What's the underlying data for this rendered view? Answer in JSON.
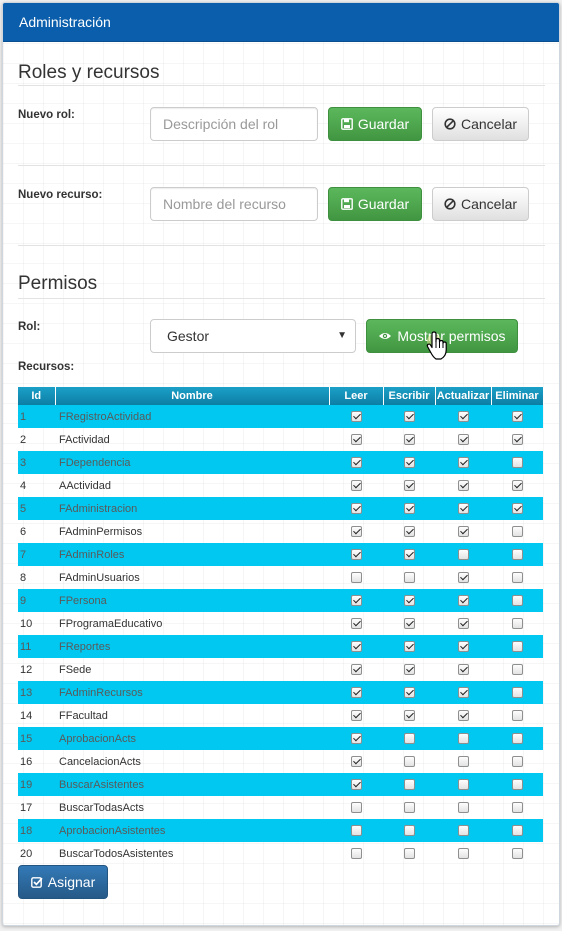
{
  "header": {
    "title": "Administración"
  },
  "roles_section": {
    "title": "Roles y recursos",
    "new_role_label": "Nuevo rol:",
    "new_role_placeholder": "Descripción del rol",
    "new_resource_label": "Nuevo recurso:",
    "new_resource_placeholder": "Nombre del recurso",
    "save_label": "Guardar",
    "cancel_label": "Cancelar"
  },
  "permisos_section": {
    "title": "Permisos",
    "role_label": "Rol:",
    "role_selected": "Gestor",
    "show_button_label": "Mostrar permisos",
    "resources_label": "Recursos:",
    "assign_label": "Asignar"
  },
  "table": {
    "columns": [
      "Id",
      "Nombre",
      "Leer",
      "Escribir",
      "Actualizar",
      "Eliminar"
    ],
    "rows": [
      {
        "id": "1",
        "name": "FRegistroActividad",
        "perms": [
          true,
          true,
          true,
          true
        ]
      },
      {
        "id": "2",
        "name": "FActividad",
        "perms": [
          true,
          true,
          true,
          true
        ]
      },
      {
        "id": "3",
        "name": "FDependencia",
        "perms": [
          true,
          true,
          true,
          false
        ]
      },
      {
        "id": "4",
        "name": "AActividad",
        "perms": [
          true,
          true,
          true,
          true
        ]
      },
      {
        "id": "5",
        "name": "FAdministracion",
        "perms": [
          true,
          true,
          true,
          true
        ]
      },
      {
        "id": "6",
        "name": "FAdminPermisos",
        "perms": [
          true,
          true,
          true,
          false
        ]
      },
      {
        "id": "7",
        "name": "FAdminRoles",
        "perms": [
          true,
          true,
          false,
          false
        ]
      },
      {
        "id": "8",
        "name": "FAdminUsuarios",
        "perms": [
          false,
          false,
          true,
          false
        ]
      },
      {
        "id": "9",
        "name": "FPersona",
        "perms": [
          true,
          true,
          true,
          false
        ]
      },
      {
        "id": "10",
        "name": "FProgramaEducativo",
        "perms": [
          true,
          true,
          true,
          false
        ]
      },
      {
        "id": "11",
        "name": "FReportes",
        "perms": [
          true,
          true,
          true,
          false
        ]
      },
      {
        "id": "12",
        "name": "FSede",
        "perms": [
          true,
          true,
          true,
          false
        ]
      },
      {
        "id": "13",
        "name": "FAdminRecursos",
        "perms": [
          true,
          true,
          true,
          false
        ]
      },
      {
        "id": "14",
        "name": "FFacultad",
        "perms": [
          true,
          true,
          true,
          false
        ]
      },
      {
        "id": "15",
        "name": "AprobacionActs",
        "perms": [
          true,
          false,
          false,
          false
        ]
      },
      {
        "id": "16",
        "name": "CancelacionActs",
        "perms": [
          true,
          false,
          false,
          false
        ]
      },
      {
        "id": "19",
        "name": "BuscarAsistentes",
        "perms": [
          true,
          false,
          false,
          false
        ]
      },
      {
        "id": "17",
        "name": "BuscarTodasActs",
        "perms": [
          false,
          false,
          false,
          false
        ]
      },
      {
        "id": "18",
        "name": "AprobacionAsistentes",
        "perms": [
          false,
          false,
          false,
          false
        ]
      },
      {
        "id": "20",
        "name": "BuscarTodosAsistentes",
        "perms": [
          false,
          false,
          false,
          false
        ]
      }
    ]
  },
  "icons": {
    "save": "floppy-disk-icon",
    "cancel": "ban-circle-icon",
    "show": "eye-icon",
    "assign": "check-square-icon",
    "cursor": "hand-pointer-icon"
  },
  "colors": {
    "header": "#0a5eab",
    "success": "#5cb85c",
    "primary": "#337ab7",
    "row_highlight": "#00c8f0",
    "table_header": "#1ba0c8"
  }
}
